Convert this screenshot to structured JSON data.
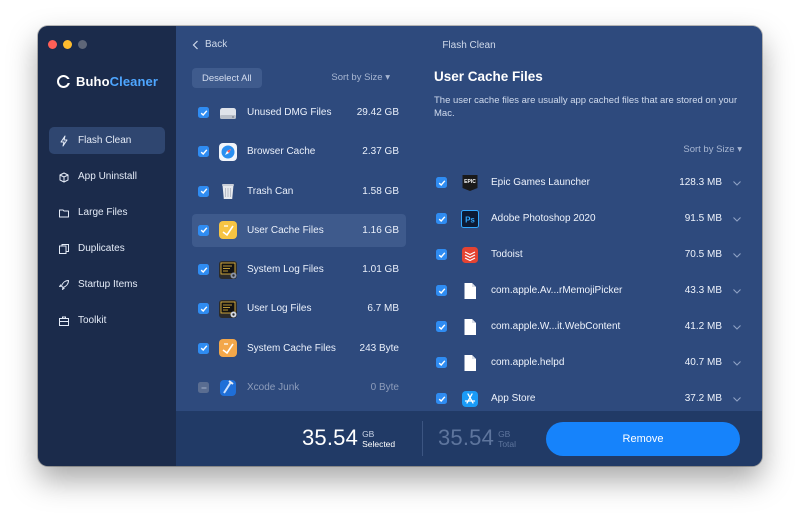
{
  "window": {
    "title": "Flash Clean",
    "back_label": "Back"
  },
  "brand": {
    "name_prefix": "Buho",
    "name_suffix": "Cleaner"
  },
  "sidebar": {
    "items": [
      {
        "label": "Flash Clean",
        "icon": "bolt-icon",
        "active": true
      },
      {
        "label": "App Uninstall",
        "icon": "box-icon",
        "active": false
      },
      {
        "label": "Large Files",
        "icon": "folder-icon",
        "active": false
      },
      {
        "label": "Duplicates",
        "icon": "duplicates-icon",
        "active": false
      },
      {
        "label": "Startup Items",
        "icon": "rocket-icon",
        "active": false
      },
      {
        "label": "Toolkit",
        "icon": "toolkit-icon",
        "active": false
      }
    ]
  },
  "list": {
    "deselect_label": "Deselect All",
    "sort_label": "Sort by Size",
    "categories": [
      {
        "label": "Unused DMG Files",
        "size": "29.42 GB",
        "checked": true,
        "selected": false,
        "icon": "disk-image-icon"
      },
      {
        "label": "Browser Cache",
        "size": "2.37 GB",
        "checked": true,
        "selected": false,
        "icon": "safari-icon"
      },
      {
        "label": "Trash Can",
        "size": "1.58 GB",
        "checked": true,
        "selected": false,
        "icon": "trash-icon"
      },
      {
        "label": "User Cache Files",
        "size": "1.16 GB",
        "checked": true,
        "selected": true,
        "icon": "cache-folder-icon"
      },
      {
        "label": "System Log Files",
        "size": "1.01 GB",
        "checked": true,
        "selected": false,
        "icon": "console-log-icon"
      },
      {
        "label": "User Log Files",
        "size": "6.7 MB",
        "checked": true,
        "selected": false,
        "icon": "console-log-icon"
      },
      {
        "label": "System Cache Files",
        "size": "243 Byte",
        "checked": true,
        "selected": false,
        "icon": "cache-folder-icon"
      },
      {
        "label": "Xcode Junk",
        "size": "0 Byte",
        "checked": false,
        "selected": false,
        "icon": "xcode-icon"
      }
    ]
  },
  "detail": {
    "title": "User Cache Files",
    "description": "The user cache files are usually app cached files that are stored on your Mac.",
    "sort_label": "Sort by Size",
    "apps": [
      {
        "name": "Epic Games Launcher",
        "size": "128.3 MB",
        "icon": "epic-games-icon",
        "icon_text": "EPIC"
      },
      {
        "name": "Adobe Photoshop 2020",
        "size": "91.5 MB",
        "icon": "photoshop-icon",
        "icon_text": "Ps"
      },
      {
        "name": "Todoist",
        "size": "70.5 MB",
        "icon": "todoist-icon"
      },
      {
        "name": "com.apple.Av...rMemojiPicker",
        "size": "43.3 MB",
        "icon": "document-icon"
      },
      {
        "name": "com.apple.W...it.WebContent",
        "size": "41.2 MB",
        "icon": "document-icon"
      },
      {
        "name": "com.apple.helpd",
        "size": "40.7 MB",
        "icon": "document-icon"
      },
      {
        "name": "App Store",
        "size": "37.2 MB",
        "icon": "app-store-icon"
      }
    ]
  },
  "footer": {
    "selected_value": "35.54",
    "selected_unit": "GB",
    "selected_label": "Selected",
    "total_value": "35.54",
    "total_unit": "GB",
    "total_label": "Total",
    "remove_label": "Remove"
  },
  "colors": {
    "accent": "#1683fb",
    "sidebar_bg": "#1b2b4b",
    "main_bg": "#2e4a7d"
  }
}
